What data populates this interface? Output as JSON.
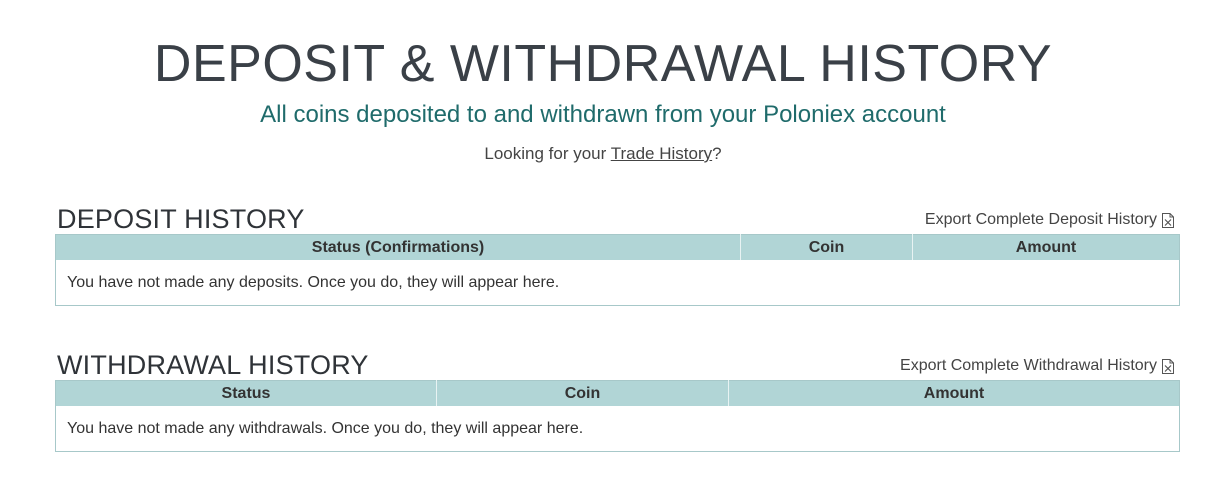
{
  "page": {
    "title": "DEPOSIT & WITHDRAWAL HISTORY",
    "subtitle": "All coins deposited to and withdrawn from your Poloniex account",
    "lookup_prefix": "Looking for your ",
    "lookup_link": "Trade History",
    "lookup_suffix": "?"
  },
  "deposit": {
    "title": "DEPOSIT HISTORY",
    "export_label": "Export Complete Deposit History",
    "columns": [
      "Status (Confirmations)",
      "Coin",
      "Amount"
    ],
    "empty_message": "You have not made any deposits. Once you do, they will appear here."
  },
  "withdrawal": {
    "title": "WITHDRAWAL HISTORY",
    "export_label": "Export Complete Withdrawal History",
    "columns": [
      "Status",
      "Coin",
      "Amount"
    ],
    "empty_message": "You have not made any withdrawals. Once you do, they will appear here."
  },
  "icons": {
    "export": "excel-file-icon"
  },
  "colors": {
    "header_bg": "#b1d5d6",
    "subtitle": "#1f6b6b",
    "border": "#a7c8c9"
  }
}
